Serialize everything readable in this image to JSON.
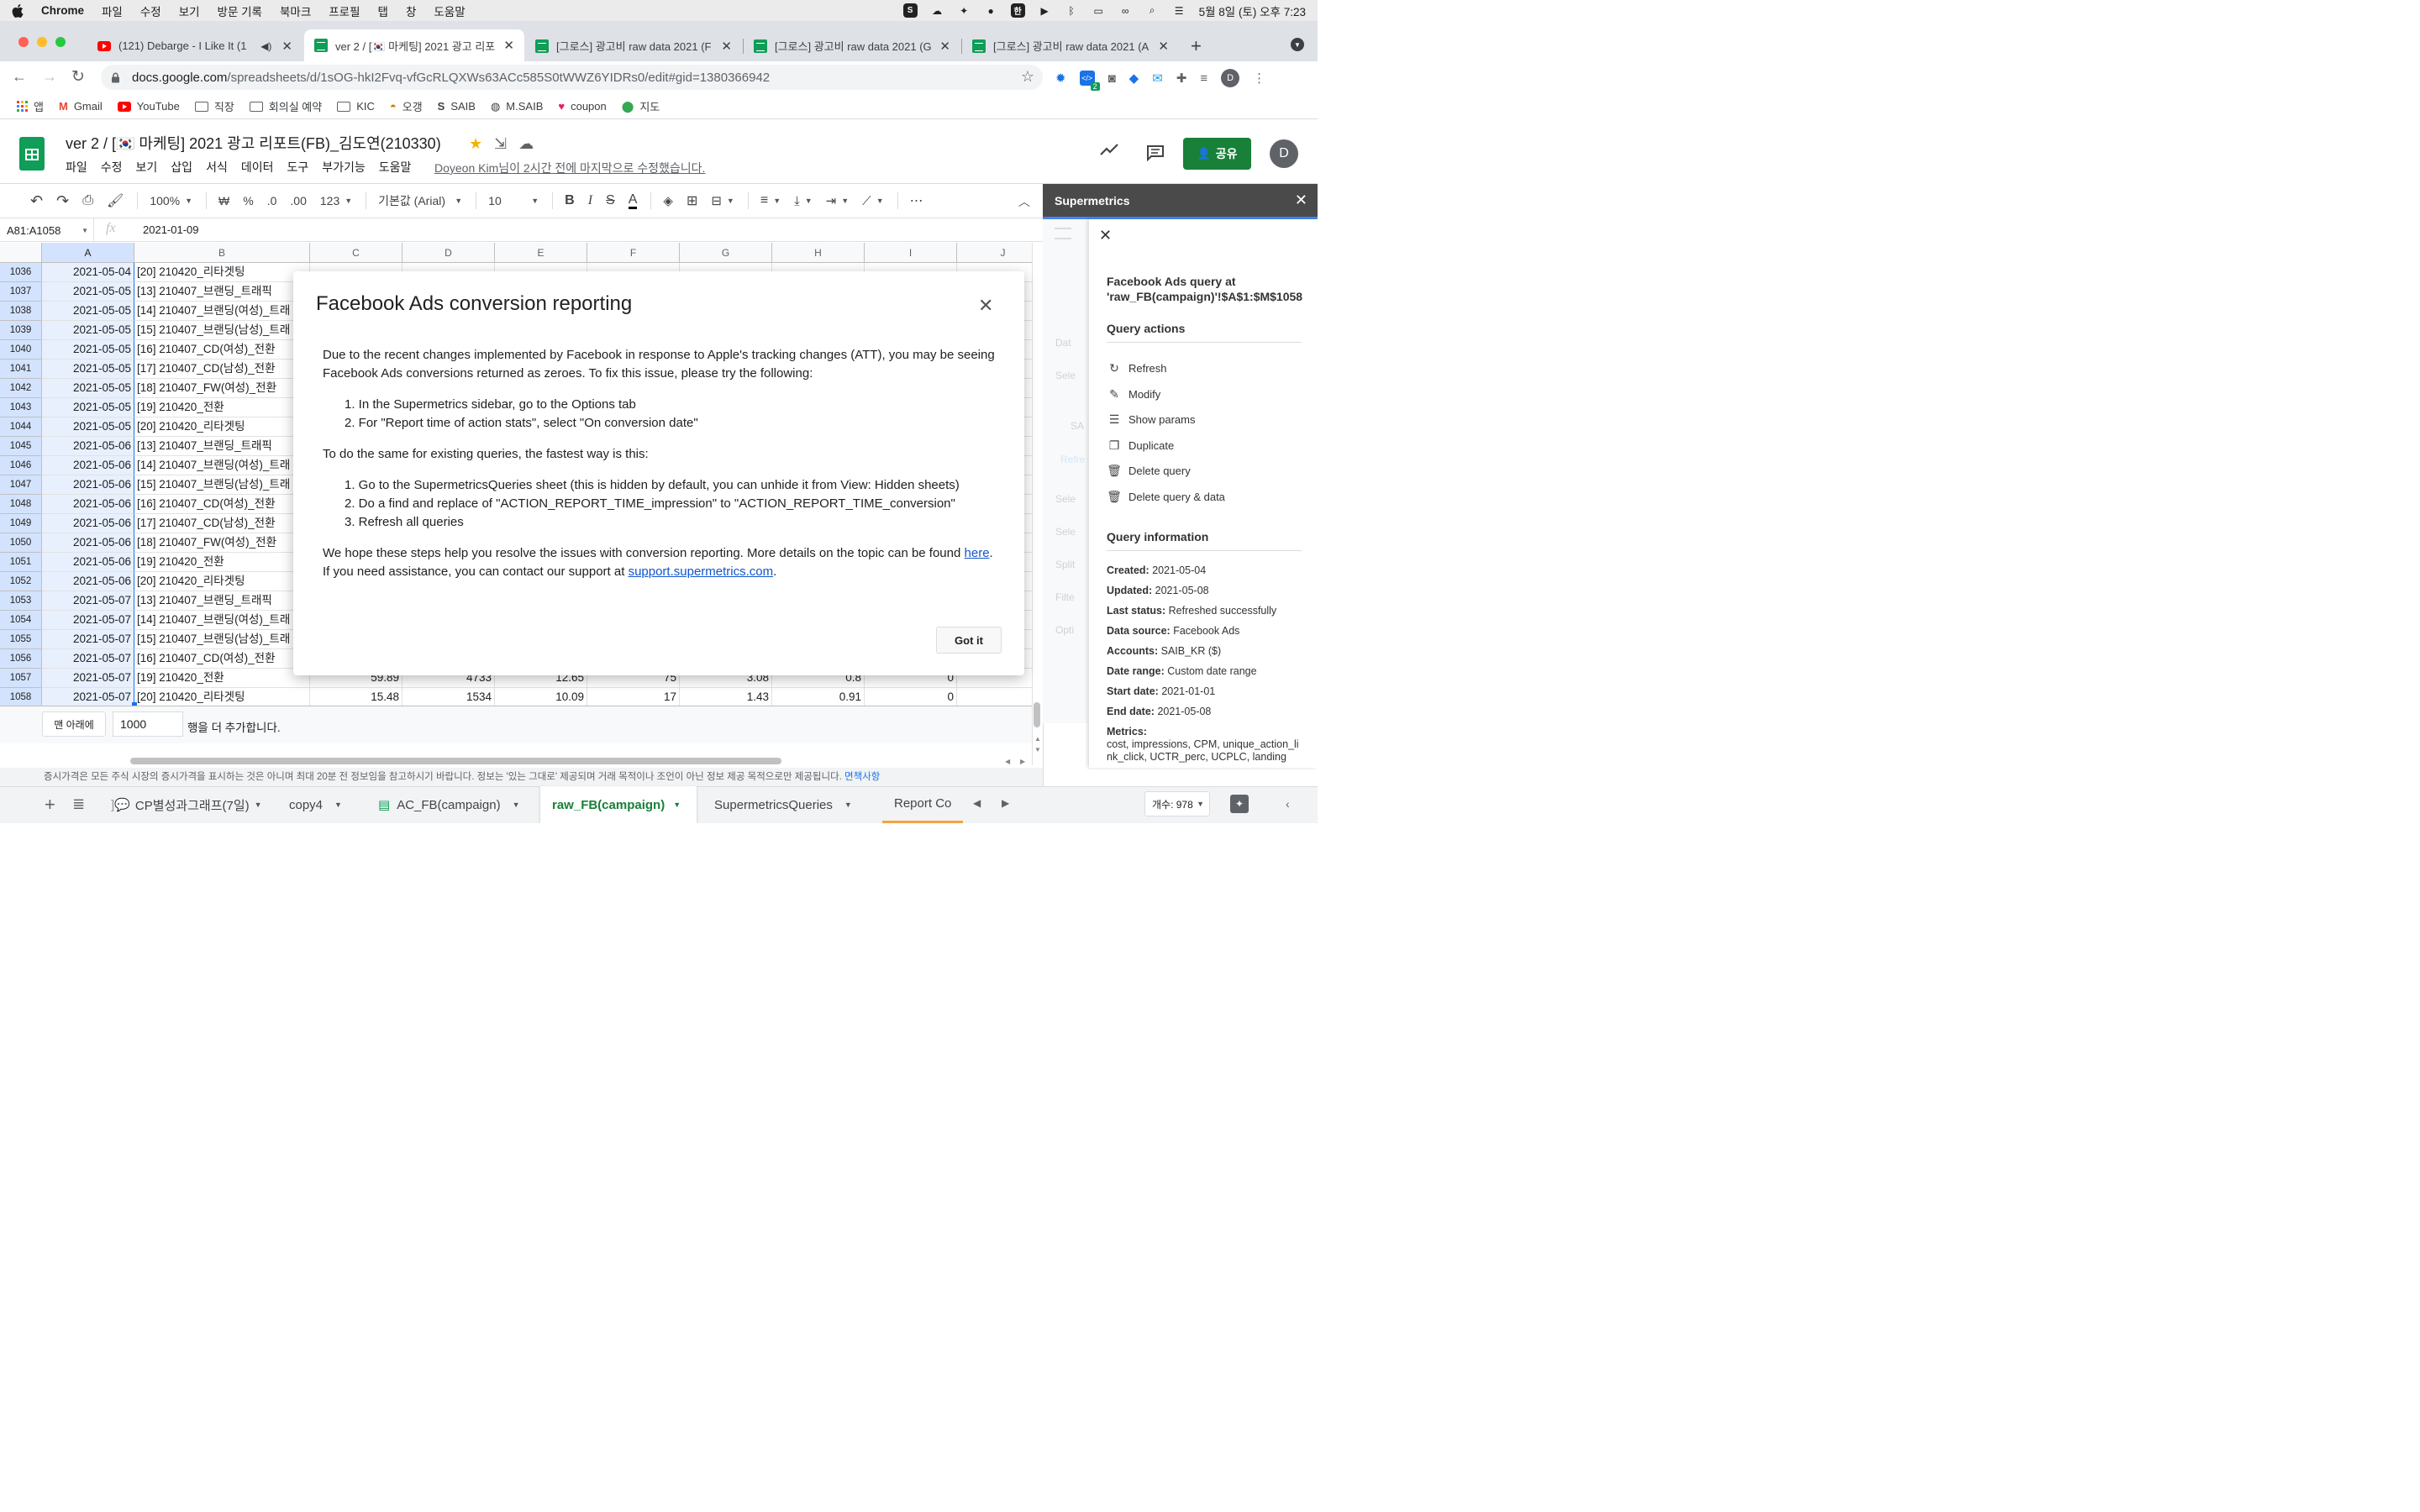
{
  "mac_menubar": {
    "app": "Chrome",
    "items": [
      "파일",
      "수정",
      "보기",
      "방문 기록",
      "북마크",
      "프로필",
      "탭",
      "창",
      "도움말"
    ],
    "clock": "5월 8일 (토) 오후 7:23",
    "status_icons": [
      "creative-cloud-icon",
      "dropbox-icon",
      "messenger-icon",
      "korean-input-icon",
      "play-icon",
      "bluetooth-icon",
      "battery-icon",
      "link-icon",
      "spotlight-icon",
      "control-center-icon"
    ]
  },
  "browser": {
    "tabs": [
      {
        "title": "(121) Debarge - I Like It (1",
        "icon": "youtube-icon"
      },
      {
        "title": "ver 2 / [🇰🇷 마케팅] 2021 광고 리포",
        "icon": "sheets-icon"
      },
      {
        "title": "[그로스] 광고비 raw data 2021 (F",
        "icon": "sheets-icon"
      },
      {
        "title": "[그로스] 광고비 raw data 2021 (G",
        "icon": "sheets-icon"
      },
      {
        "title": "[그로스] 광고비 raw data 2021 (A",
        "icon": "sheets-icon"
      }
    ],
    "url_host": "docs.google.com",
    "url_path": "/spreadsheets/d/1sOG-hkI2Fvq-vfGcRLQXWs63ACc585S0tWWZ6YIDRs0/edit#gid=1380366942",
    "extension_badge": "2",
    "profile_initial": "D",
    "bookmarks": [
      {
        "label": "앱",
        "icon": "apps-grid-icon"
      },
      {
        "label": "Gmail",
        "icon": "gmail-icon"
      },
      {
        "label": "YouTube",
        "icon": "youtube-icon"
      },
      {
        "label": "직장",
        "icon": "folder-icon"
      },
      {
        "label": "회의실 예약",
        "icon": "folder-icon"
      },
      {
        "label": "KIC",
        "icon": "folder-icon"
      },
      {
        "label": "오갱",
        "icon": "burger-icon"
      },
      {
        "label": "SAIB",
        "icon": "s-logo-icon"
      },
      {
        "label": "M.SAIB",
        "icon": "globe-icon"
      },
      {
        "label": "coupon",
        "icon": "heart-icon"
      },
      {
        "label": "지도",
        "icon": "maps-pin-icon"
      }
    ]
  },
  "doc": {
    "title": "ver 2 / [🇰🇷 마케팅] 2021 광고 리포트(FB)_김도연(210330)",
    "menu": [
      "파일",
      "수정",
      "보기",
      "삽입",
      "서식",
      "데이터",
      "도구",
      "부가기능",
      "도움말"
    ],
    "last_edit": "Doyeon Kim님이 2시간 전에 마지막으로 수정했습니다.",
    "share_label": "공유",
    "avatar_initial": "D"
  },
  "toolbar": {
    "zoom": "100%",
    "currency": "₩",
    "percent": "%",
    "dec_less": ".0",
    "dec_more": ".00",
    "format_more": "123",
    "font": "기본값 (Arial)",
    "font_size": "10"
  },
  "formula_bar": {
    "name_box": "A81:A1058",
    "fx": "fx",
    "value": "2021-01-09"
  },
  "columns": [
    "A",
    "B",
    "C",
    "D",
    "E",
    "F",
    "G",
    "H",
    "I",
    "J"
  ],
  "rows": [
    {
      "n": "1036",
      "date": "2021-05-04",
      "name": "[20] 210420_리타겟팅",
      "c": "",
      "d": "",
      "e": "",
      "f": "",
      "g": "",
      "h": "",
      "i": ""
    },
    {
      "n": "1037",
      "date": "2021-05-05",
      "name": "[13] 210407_브랜딩_트래픽",
      "c": "",
      "d": "",
      "e": "",
      "f": "",
      "g": "",
      "h": "",
      "i": ""
    },
    {
      "n": "1038",
      "date": "2021-05-05",
      "name": "[14] 210407_브랜딩(여성)_트래",
      "c": "",
      "d": "",
      "e": "",
      "f": "",
      "g": "",
      "h": "",
      "i": ""
    },
    {
      "n": "1039",
      "date": "2021-05-05",
      "name": "[15] 210407_브랜딩(남성)_트래",
      "c": "",
      "d": "",
      "e": "",
      "f": "",
      "g": "",
      "h": "",
      "i": ""
    },
    {
      "n": "1040",
      "date": "2021-05-05",
      "name": "[16] 210407_CD(여성)_전환",
      "c": "",
      "d": "",
      "e": "",
      "f": "",
      "g": "",
      "h": "",
      "i": ""
    },
    {
      "n": "1041",
      "date": "2021-05-05",
      "name": "[17] 210407_CD(남성)_전환",
      "c": "",
      "d": "",
      "e": "",
      "f": "",
      "g": "",
      "h": "",
      "i": ""
    },
    {
      "n": "1042",
      "date": "2021-05-05",
      "name": "[18] 210407_FW(여성)_전환",
      "c": "",
      "d": "",
      "e": "",
      "f": "",
      "g": "",
      "h": "",
      "i": ""
    },
    {
      "n": "1043",
      "date": "2021-05-05",
      "name": "[19] 210420_전환",
      "c": "",
      "d": "",
      "e": "",
      "f": "",
      "g": "",
      "h": "",
      "i": ""
    },
    {
      "n": "1044",
      "date": "2021-05-05",
      "name": "[20] 210420_리타겟팅",
      "c": "",
      "d": "",
      "e": "",
      "f": "",
      "g": "",
      "h": "",
      "i": ""
    },
    {
      "n": "1045",
      "date": "2021-05-06",
      "name": "[13] 210407_브랜딩_트래픽",
      "c": "",
      "d": "",
      "e": "",
      "f": "",
      "g": "",
      "h": "",
      "i": ""
    },
    {
      "n": "1046",
      "date": "2021-05-06",
      "name": "[14] 210407_브랜딩(여성)_트래",
      "c": "",
      "d": "",
      "e": "",
      "f": "",
      "g": "",
      "h": "",
      "i": ""
    },
    {
      "n": "1047",
      "date": "2021-05-06",
      "name": "[15] 210407_브랜딩(남성)_트래",
      "c": "",
      "d": "",
      "e": "",
      "f": "",
      "g": "",
      "h": "",
      "i": ""
    },
    {
      "n": "1048",
      "date": "2021-05-06",
      "name": "[16] 210407_CD(여성)_전환",
      "c": "",
      "d": "",
      "e": "",
      "f": "",
      "g": "",
      "h": "",
      "i": ""
    },
    {
      "n": "1049",
      "date": "2021-05-06",
      "name": "[17] 210407_CD(남성)_전환",
      "c": "",
      "d": "",
      "e": "",
      "f": "",
      "g": "",
      "h": "",
      "i": ""
    },
    {
      "n": "1050",
      "date": "2021-05-06",
      "name": "[18] 210407_FW(여성)_전환",
      "c": "",
      "d": "",
      "e": "",
      "f": "",
      "g": "",
      "h": "",
      "i": ""
    },
    {
      "n": "1051",
      "date": "2021-05-06",
      "name": "[19] 210420_전환",
      "c": "",
      "d": "",
      "e": "",
      "f": "",
      "g": "",
      "h": "",
      "i": ""
    },
    {
      "n": "1052",
      "date": "2021-05-06",
      "name": "[20] 210420_리타겟팅",
      "c": "",
      "d": "",
      "e": "",
      "f": "",
      "g": "",
      "h": "",
      "i": ""
    },
    {
      "n": "1053",
      "date": "2021-05-07",
      "name": "[13] 210407_브랜딩_트래픽",
      "c": "",
      "d": "",
      "e": "",
      "f": "",
      "g": "",
      "h": "",
      "i": ""
    },
    {
      "n": "1054",
      "date": "2021-05-07",
      "name": "[14] 210407_브랜딩(여성)_트래",
      "c": "",
      "d": "",
      "e": "",
      "f": "",
      "g": "",
      "h": "",
      "i": ""
    },
    {
      "n": "1055",
      "date": "2021-05-07",
      "name": "[15] 210407_브랜딩(남성)_트래",
      "c": "",
      "d": "",
      "e": "",
      "f": "",
      "g": "",
      "h": "",
      "i": ""
    },
    {
      "n": "1056",
      "date": "2021-05-07",
      "name": "[16] 210407_CD(여성)_전환",
      "c": "",
      "d": "",
      "e": "",
      "f": "",
      "g": "",
      "h": "",
      "i": ""
    },
    {
      "n": "1057",
      "date": "2021-05-07",
      "name": "[19] 210420_전환",
      "c": "59.89",
      "d": "4733",
      "e": "12.65",
      "f": "75",
      "g": "3.08",
      "h": "0.8",
      "i": "0"
    },
    {
      "n": "1058",
      "date": "2021-05-07",
      "name": "[20] 210420_리타겟팅",
      "c": "15.48",
      "d": "1534",
      "e": "10.09",
      "f": "17",
      "g": "1.43",
      "h": "0.91",
      "i": "0"
    }
  ],
  "add_rows": {
    "button": "맨 아래에",
    "count": "1000",
    "label": "행을 더 추가합니다."
  },
  "disclaimer": {
    "text": "증시가격은 모든 주식 시장의 증시가격을 표시하는 것은 아니며 최대 20분 전 정보임을 참고하시기 바랍니다. 정보는 '있는 그대로' 제공되며 거래 목적이나 조언이 아닌 정보 제공 목적으로만 제공됩니다.",
    "link": "면책사항"
  },
  "sheet_tabs": [
    {
      "label": "CP별성과그래프(7일)",
      "active": false
    },
    {
      "label": "copy4",
      "active": false
    },
    {
      "label": "AC_FB(campaign)",
      "active": false
    },
    {
      "label": "raw_FB(campaign)",
      "active": true
    },
    {
      "label": "SupermetricsQueries",
      "active": false
    },
    {
      "label": "Report Co",
      "active": false
    }
  ],
  "count_box": "개수: 978",
  "sidebar": {
    "title": "Supermetrics",
    "query_title": "Facebook Ads query at 'raw_FB(campaign)'!$A$1:$M$1058",
    "actions_heading": "Query actions",
    "actions": [
      {
        "label": "Refresh",
        "icon": "refresh-icon"
      },
      {
        "label": "Modify",
        "icon": "pencil-icon"
      },
      {
        "label": "Show params",
        "icon": "sliders-icon"
      },
      {
        "label": "Duplicate",
        "icon": "copy-icon"
      },
      {
        "label": "Delete query",
        "icon": "trash-icon"
      },
      {
        "label": "Delete query & data",
        "icon": "trash-multi-icon"
      }
    ],
    "info_heading": "Query information",
    "info": [
      {
        "key": "Created:",
        "value": "2021-05-04"
      },
      {
        "key": "Updated:",
        "value": "2021-05-08"
      },
      {
        "key": "Last status:",
        "value": "Refreshed successfully"
      },
      {
        "key": "Data source:",
        "value": "Facebook Ads"
      },
      {
        "key": "Accounts:",
        "value": "SAIB_KR ($)"
      },
      {
        "key": "Date range:",
        "value": "Custom date range"
      },
      {
        "key": "Start date:",
        "value": "2021-01-01"
      },
      {
        "key": "End date:",
        "value": "2021-05-08"
      }
    ],
    "metrics_key": "Metrics:",
    "metrics_value": "cost, impressions, CPM, unique_action_link_click, UCTR_perc, UCPLC, landing",
    "ghost_labels": [
      "Dat",
      "Sele",
      "SA",
      "Refre",
      "Sele",
      "Sele",
      "Split",
      "Filte",
      "Opti"
    ]
  },
  "modal": {
    "title": "Facebook Ads conversion reporting",
    "p1": "Due to the recent changes implemented by Facebook in response to Apple's tracking changes (ATT), you may be seeing Facebook Ads conversions returned as zeroes. To fix this issue, please try the following:",
    "steps1": [
      "1.  In the Supermetrics sidebar, go to the Options tab",
      "2.  For \"Report time of action stats\", select \"On conversion date\""
    ],
    "p2": "To do the same for existing queries, the fastest way is this:",
    "steps2": [
      "1.  Go to the SupermetricsQueries sheet (this is hidden by default, you can unhide it from View: Hidden sheets)",
      "2.  Do a find and replace of \"ACTION_REPORT_TIME_impression\" to \"ACTION_REPORT_TIME_conversion\"",
      "3.  Refresh all queries"
    ],
    "p3a": "We hope these steps help you resolve the issues with conversion reporting. More details on the topic can be found",
    "p3_link1": "here",
    "p3b": ". If you need assistance, you can contact our support at",
    "p3_link2": "support.supermetrics.com",
    "p3c": ".",
    "button": "Got it"
  },
  "colors": {
    "sheets_green": "#188038",
    "selection_blue": "#d3e3fd",
    "sidebar_header": "#4a4a4a",
    "link_blue": "#1155cc"
  }
}
